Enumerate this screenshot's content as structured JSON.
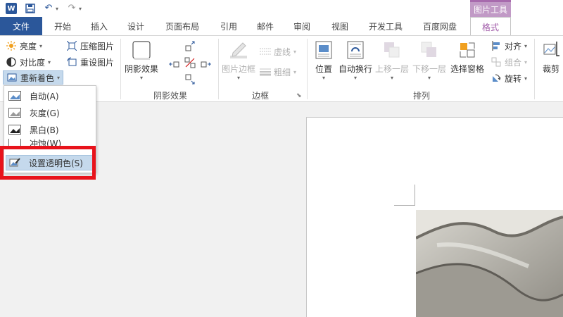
{
  "qat": {
    "logo": "W",
    "save": "💾",
    "undo": "↶",
    "redo": "↷",
    "customize": "▾"
  },
  "context_tab": {
    "label": "图片工具"
  },
  "tabs": [
    {
      "label": "文件"
    },
    {
      "label": "开始"
    },
    {
      "label": "插入"
    },
    {
      "label": "设计"
    },
    {
      "label": "页面布局"
    },
    {
      "label": "引用"
    },
    {
      "label": "邮件"
    },
    {
      "label": "审阅"
    },
    {
      "label": "视图"
    },
    {
      "label": "开发工具"
    },
    {
      "label": "百度网盘"
    },
    {
      "label": "格式"
    }
  ],
  "ribbon": {
    "adjust": {
      "brightness": "亮度",
      "contrast": "对比度",
      "recolor": "重新着色",
      "compress": "压缩图片",
      "reset": "重设图片"
    },
    "shadow": {
      "shadow_effects": "阴影效果",
      "label": "阴影效果"
    },
    "border": {
      "picture_border": "图片边框",
      "dashes": "虚线",
      "weight": "粗细",
      "label": "边框"
    },
    "arrange": {
      "position": "位置",
      "wrap": "自动换行",
      "bring_forward": "上移一层",
      "send_backward": "下移一层",
      "selection_pane": "选择窗格",
      "align": "对齐",
      "group": "组合",
      "rotate": "旋转",
      "label": "排列"
    },
    "size": {
      "crop": "裁剪"
    }
  },
  "dropdown": {
    "items": [
      {
        "label": "自动(A)"
      },
      {
        "label": "灰度(G)"
      },
      {
        "label": "黑白(B)"
      },
      {
        "label": "冲蚀(W)"
      },
      {
        "label": "设置透明色(S)"
      }
    ]
  },
  "colors": {
    "file_tab": "#2b579a",
    "context_tab": "#c19ac6",
    "active_tab_text": "#a05aa8",
    "highlight": "#c5d9ec",
    "red_box": "#e8131b"
  }
}
